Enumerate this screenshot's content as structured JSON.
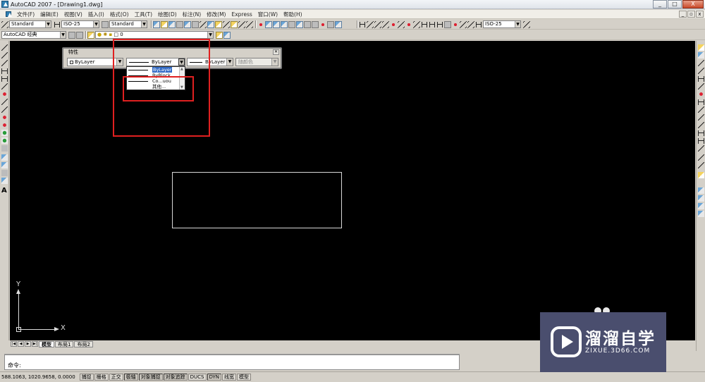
{
  "window": {
    "title": "AutoCAD 2007 - [Drawing1.dwg]",
    "controls": [
      "_",
      "□",
      "X"
    ]
  },
  "menubar": {
    "items": [
      "文件(F)",
      "编辑(E)",
      "视图(V)",
      "插入(I)",
      "格式(O)",
      "工具(T)",
      "绘图(D)",
      "标注(N)",
      "修改(M)",
      "Express",
      "窗口(W)",
      "帮助(H)"
    ]
  },
  "toolbar": {
    "text_style": "Standard",
    "dim_style": "ISO-25",
    "table_style": "Standard",
    "dim_style_right": "ISO-25",
    "workspace": "AutoCAD 经典",
    "layer": "0"
  },
  "properties_panel": {
    "title": "特性",
    "color": "ByLayer",
    "linetype": "ByLayer",
    "lineweight": "ByLayer",
    "plot_style": "随颜色"
  },
  "linetype_dropdown": {
    "items": [
      "ByLayer",
      "ByBlock",
      "Co...uou",
      "其他..."
    ],
    "selected_index": 0
  },
  "canvas": {
    "background": "#000000",
    "ucs_x": "X",
    "ucs_y": "Y"
  },
  "layout_tabs": [
    "模型",
    "布局1",
    "布局2"
  ],
  "command": {
    "prompt": "命令:"
  },
  "statusbar": {
    "coordinates": "588.1063, 1020.9658, 0.0000",
    "toggles": [
      "捕捉",
      "栅格",
      "正交",
      "极轴",
      "对象捕捉",
      "对象追踪",
      "DUCS",
      "DYN",
      "线宽",
      "模型"
    ]
  },
  "watermark": {
    "name": "溜溜自学",
    "url": "ZIXUE.3D66.COM"
  },
  "colors": {
    "highlight": "#e02020",
    "chrome": "#d4d0c8",
    "selection": "#316ac5"
  }
}
